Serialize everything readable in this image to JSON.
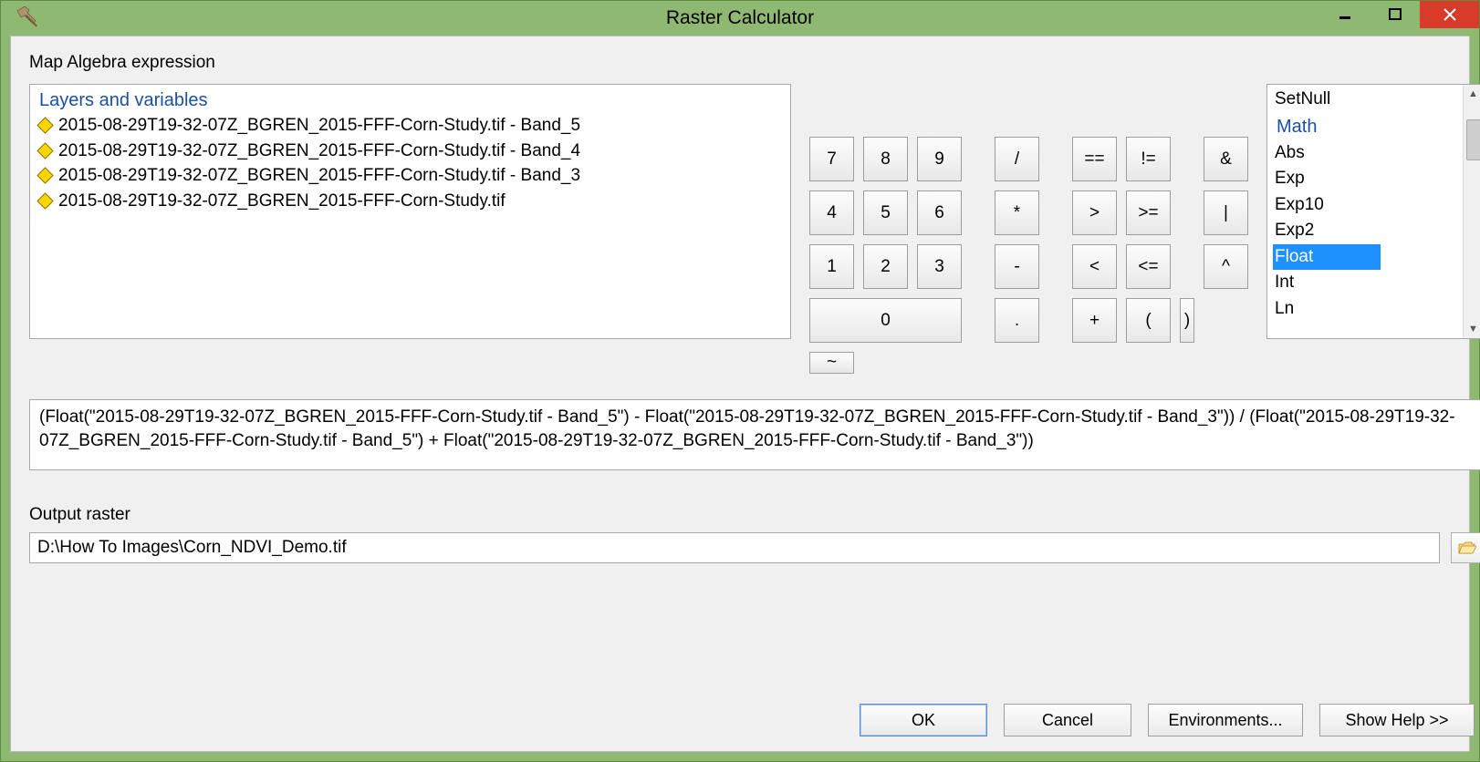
{
  "window": {
    "title": "Raster Calculator"
  },
  "section_label": "Map Algebra expression",
  "layers": {
    "header": "Layers and variables",
    "items": [
      "2015-08-29T19-32-07Z_BGREN_2015-FFF-Corn-Study.tif - Band_5",
      "2015-08-29T19-32-07Z_BGREN_2015-FFF-Corn-Study.tif - Band_4",
      "2015-08-29T19-32-07Z_BGREN_2015-FFF-Corn-Study.tif - Band_3",
      "2015-08-29T19-32-07Z_BGREN_2015-FFF-Corn-Study.tif"
    ]
  },
  "keys": {
    "k7": "7",
    "k8": "8",
    "k9": "9",
    "div": "/",
    "eq": "==",
    "neq": "!=",
    "amp": "&",
    "k4": "4",
    "k5": "5",
    "k6": "6",
    "mul": "*",
    "gt": ">",
    "gte": ">=",
    "pipe": "|",
    "k1": "1",
    "k2": "2",
    "k3": "3",
    "minus": "-",
    "lt": "<",
    "lte": "<=",
    "caret": "^",
    "k0": "0",
    "dot": ".",
    "plus": "+",
    "lpar": "(",
    "rpar": ")",
    "tilde": "~"
  },
  "functions": {
    "top_item": "SetNull",
    "category": "Math",
    "items": [
      "Abs",
      "Exp",
      "Exp10",
      "Exp2",
      "Float",
      "Int",
      "Ln"
    ],
    "selected": "Float"
  },
  "expression": "(Float(\"2015-08-29T19-32-07Z_BGREN_2015-FFF-Corn-Study.tif - Band_5\") - Float(\"2015-08-29T19-32-07Z_BGREN_2015-FFF-Corn-Study.tif - Band_3\")) / (Float(\"2015-08-29T19-32-07Z_BGREN_2015-FFF-Corn-Study.tif - Band_5\") + Float(\"2015-08-29T19-32-07Z_BGREN_2015-FFF-Corn-Study.tif - Band_3\"))",
  "output": {
    "label": "Output raster",
    "value": "D:\\How To Images\\Corn_NDVI_Demo.tif"
  },
  "buttons": {
    "ok": "OK",
    "cancel": "Cancel",
    "env": "Environments...",
    "help": "Show Help >>"
  }
}
